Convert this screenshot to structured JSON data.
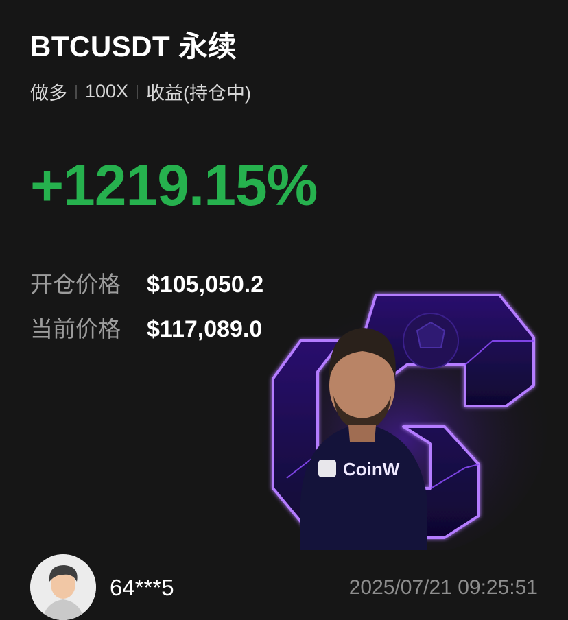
{
  "header": {
    "symbol": "BTCUSDT 永续",
    "direction": "做多",
    "leverage": "100X",
    "status": "收益(持仓中)"
  },
  "pnl": {
    "value": "+1219.15%",
    "color": "#26b14e"
  },
  "prices": {
    "entry_label": "开仓价格",
    "entry_value": "$105,050.2",
    "current_label": "当前价格",
    "current_value": "$117,089.0"
  },
  "promo": {
    "brand_text": "CoinW",
    "accent_color": "#7a2cff"
  },
  "footer": {
    "username": "64***5",
    "timestamp": "2025/07/21 09:25:51"
  }
}
